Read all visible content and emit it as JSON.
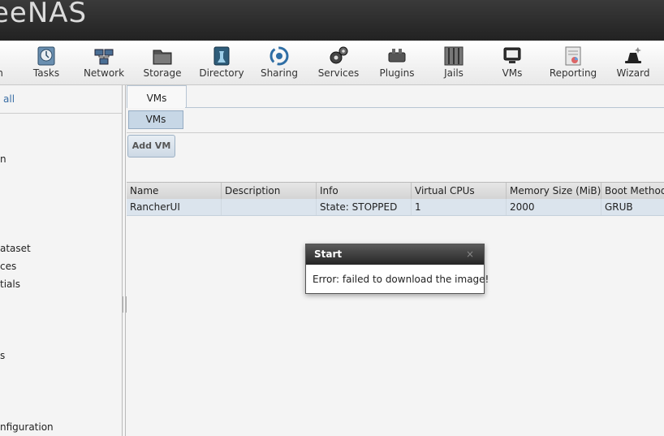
{
  "header": {
    "logo": "eeNAS",
    "logo_tm": "™"
  },
  "toolbar": {
    "items": [
      {
        "label": "n",
        "icon": "system-icon"
      },
      {
        "label": "Tasks",
        "icon": "tasks-icon"
      },
      {
        "label": "Network",
        "icon": "network-icon"
      },
      {
        "label": "Storage",
        "icon": "storage-icon"
      },
      {
        "label": "Directory",
        "icon": "directory-icon"
      },
      {
        "label": "Sharing",
        "icon": "sharing-icon"
      },
      {
        "label": "Services",
        "icon": "services-icon"
      },
      {
        "label": "Plugins",
        "icon": "plugins-icon"
      },
      {
        "label": "Jails",
        "icon": "jails-icon"
      },
      {
        "label": "VMs",
        "icon": "vms-icon"
      },
      {
        "label": "Reporting",
        "icon": "reporting-icon"
      },
      {
        "label": "Wizard",
        "icon": "wizard-icon"
      }
    ]
  },
  "left": {
    "top_link": "all",
    "tree": [
      "n",
      "ataset",
      "ces",
      "tials",
      "s",
      "nfiguration"
    ]
  },
  "main": {
    "tab": "VMs",
    "subtab": "VMs",
    "add_button": "Add VM",
    "columns": [
      "Name",
      "Description",
      "Info",
      "Virtual CPUs",
      "Memory Size (MiB)",
      "Boot Method"
    ],
    "rows": [
      [
        "RancherUI",
        "",
        "State: STOPPED",
        "1",
        "2000",
        "GRUB"
      ]
    ]
  },
  "dialog": {
    "title": "Start",
    "close": "×",
    "message": "Error: failed to download the image!"
  },
  "colors": {
    "header": "#2a2a2a",
    "selected_row": "#dbe4ed",
    "link": "#3a6ea5"
  }
}
